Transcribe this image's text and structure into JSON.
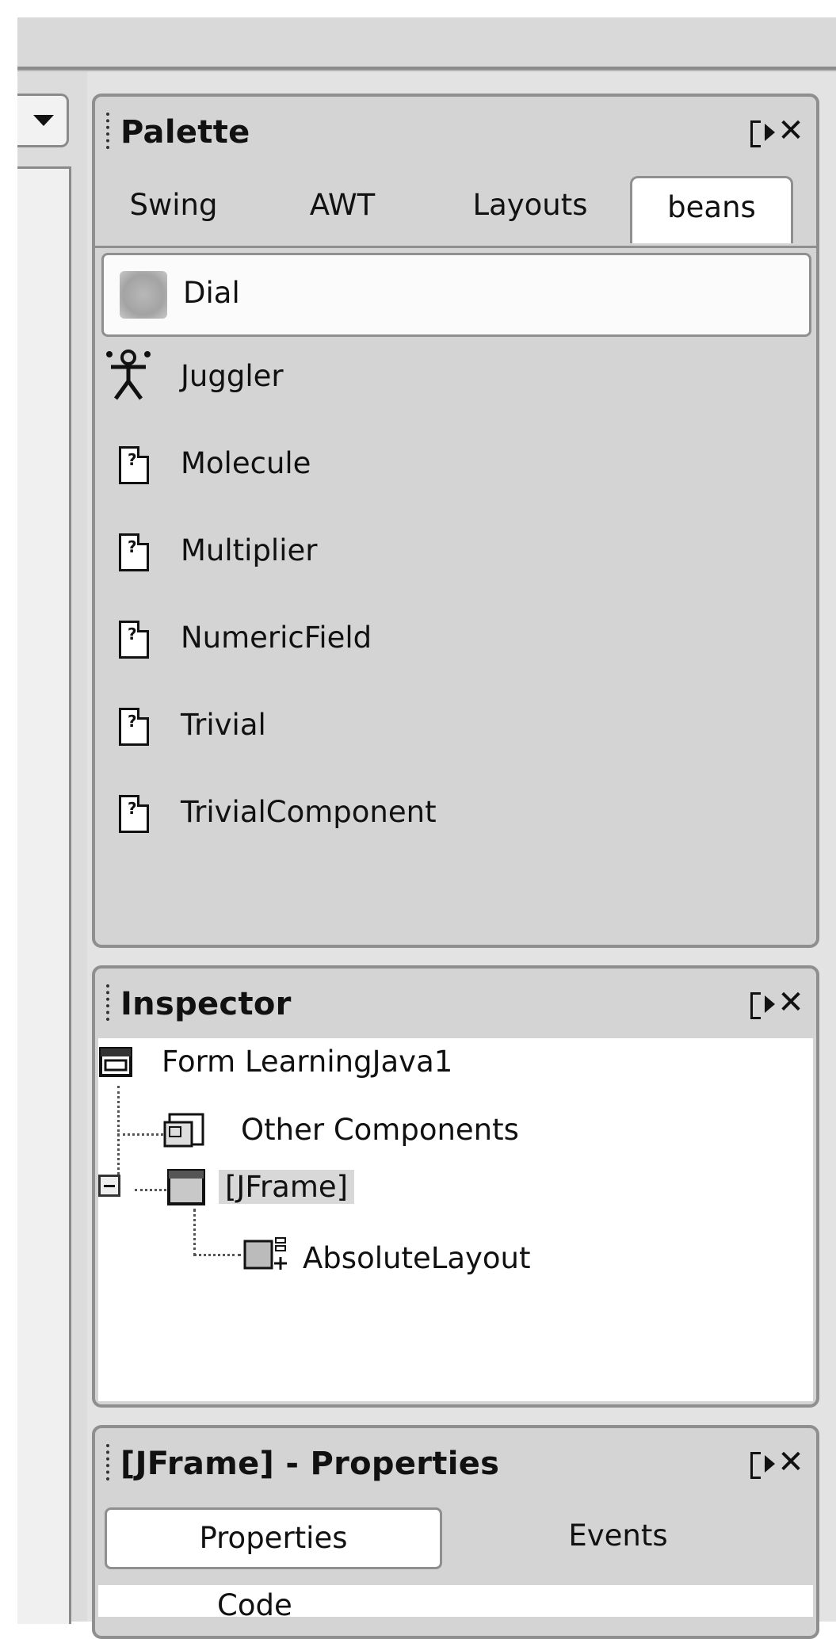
{
  "left": {
    "dropdown_icon": "chevron-down-icon"
  },
  "palette": {
    "title": "Palette",
    "tabs": [
      {
        "label": "Swing",
        "active": false
      },
      {
        "label": "AWT",
        "active": false
      },
      {
        "label": "Layouts",
        "active": false
      },
      {
        "label": "beans",
        "active": true
      }
    ],
    "items": [
      {
        "label": "Dial",
        "icon": "dial-icon",
        "selected": true
      },
      {
        "label": "Juggler",
        "icon": "juggler-icon",
        "selected": false
      },
      {
        "label": "Molecule",
        "icon": "bean-icon",
        "selected": false
      },
      {
        "label": "Multiplier",
        "icon": "bean-icon",
        "selected": false
      },
      {
        "label": "NumericField",
        "icon": "bean-icon",
        "selected": false
      },
      {
        "label": "Trivial",
        "icon": "bean-icon",
        "selected": false
      },
      {
        "label": "TrivialComponent",
        "icon": "bean-icon",
        "selected": false
      }
    ]
  },
  "inspector": {
    "title": "Inspector",
    "nodes": [
      {
        "label": "Form LearningJava1",
        "icon": "form-icon"
      },
      {
        "label": "Other Components",
        "icon": "folder-icon"
      },
      {
        "label": "[JFrame]",
        "icon": "frame-icon",
        "selected": true
      },
      {
        "label": "AbsoluteLayout",
        "icon": "layout-icon"
      }
    ]
  },
  "properties": {
    "title": "[JFrame] - Properties",
    "tabs": [
      {
        "label": "Properties",
        "active": true
      },
      {
        "label": "Events",
        "active": false
      }
    ],
    "section_label": "Code"
  },
  "colors": {
    "panel_bg": "#d4d4d4",
    "border": "#8f8f8f",
    "text": "#111111"
  }
}
